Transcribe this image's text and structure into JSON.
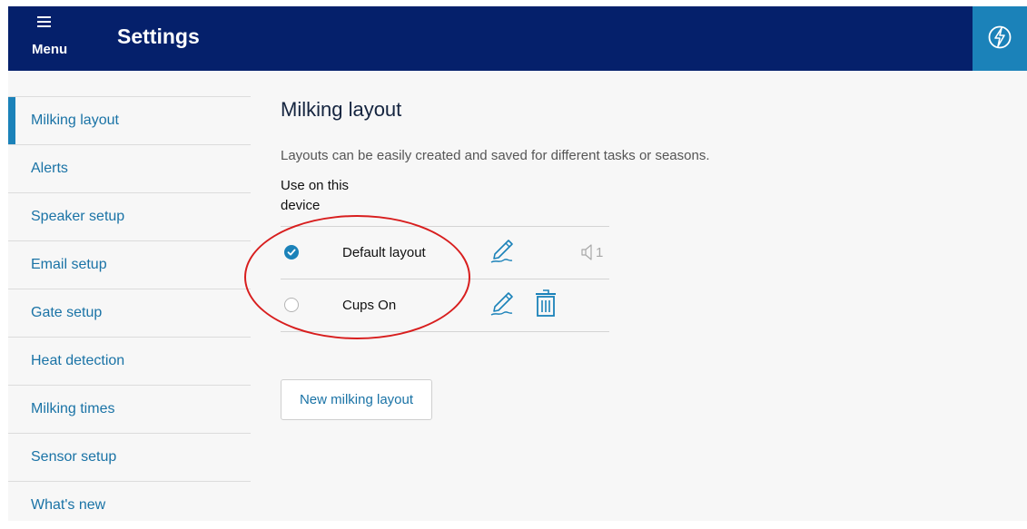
{
  "header": {
    "menu_label": "Menu",
    "title": "Settings",
    "menu_icon": "hamburger-icon",
    "sync_icon": "lightning-icon"
  },
  "sidebar": {
    "items": [
      {
        "label": "Milking layout",
        "active": true
      },
      {
        "label": "Alerts"
      },
      {
        "label": "Speaker setup"
      },
      {
        "label": "Email setup"
      },
      {
        "label": "Gate setup"
      },
      {
        "label": "Heat detection"
      },
      {
        "label": "Milking times"
      },
      {
        "label": "Sensor setup"
      },
      {
        "label": "What's new"
      }
    ]
  },
  "main": {
    "title": "Milking layout",
    "description": "Layouts can be easily created and saved for different tasks or seasons.",
    "column_header": "Use on this device",
    "layouts": [
      {
        "name": "Default layout",
        "selected": true,
        "speaker_count": "1"
      },
      {
        "name": "Cups On",
        "selected": false
      }
    ],
    "new_button": "New milking layout"
  },
  "colors": {
    "header_bg": "#05206b",
    "accent": "#1b82b9",
    "link": "#1a73a6",
    "annotation": "#d81e1e"
  }
}
